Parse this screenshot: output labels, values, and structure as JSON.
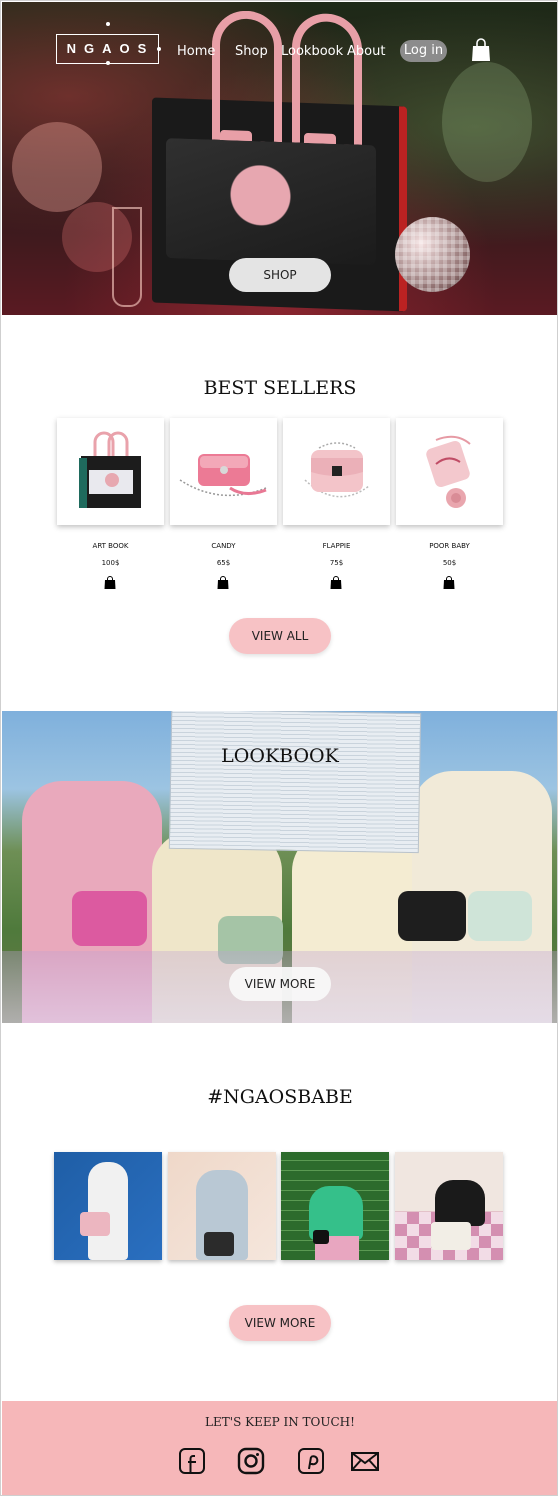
{
  "header": {
    "logo": "NGAOS",
    "nav": [
      "Home",
      "Shop",
      "Lookbook",
      "About"
    ],
    "login_label": "Log in",
    "cart_icon": "shopping-bag-icon"
  },
  "hero": {
    "shop_label": "SHOP"
  },
  "best_sellers": {
    "title": "BEST SELLERS",
    "products": [
      {
        "name": "ART BOOK",
        "price": "100$"
      },
      {
        "name": "CANDY",
        "price": "65$"
      },
      {
        "name": "FLAPPIE",
        "price": "75$"
      },
      {
        "name": "POOR BABY",
        "price": "50$"
      }
    ],
    "view_all_label": "VIEW ALL"
  },
  "lookbook": {
    "title": "LOOKBOOK",
    "view_more_label": "VIEW MORE"
  },
  "ngaosbabe": {
    "title": "#NGAOSBABE",
    "view_more_label": "VIEW MORE"
  },
  "footer": {
    "title": "LET'S KEEP IN TOUCH!",
    "social_icons": [
      "facebook-icon",
      "instagram-icon",
      "pinterest-icon",
      "mail-icon"
    ]
  },
  "colors": {
    "accent_pink": "#f7c2c5",
    "footer_pink": "#f6b7b9",
    "login_gray": "#8c8c8c"
  }
}
